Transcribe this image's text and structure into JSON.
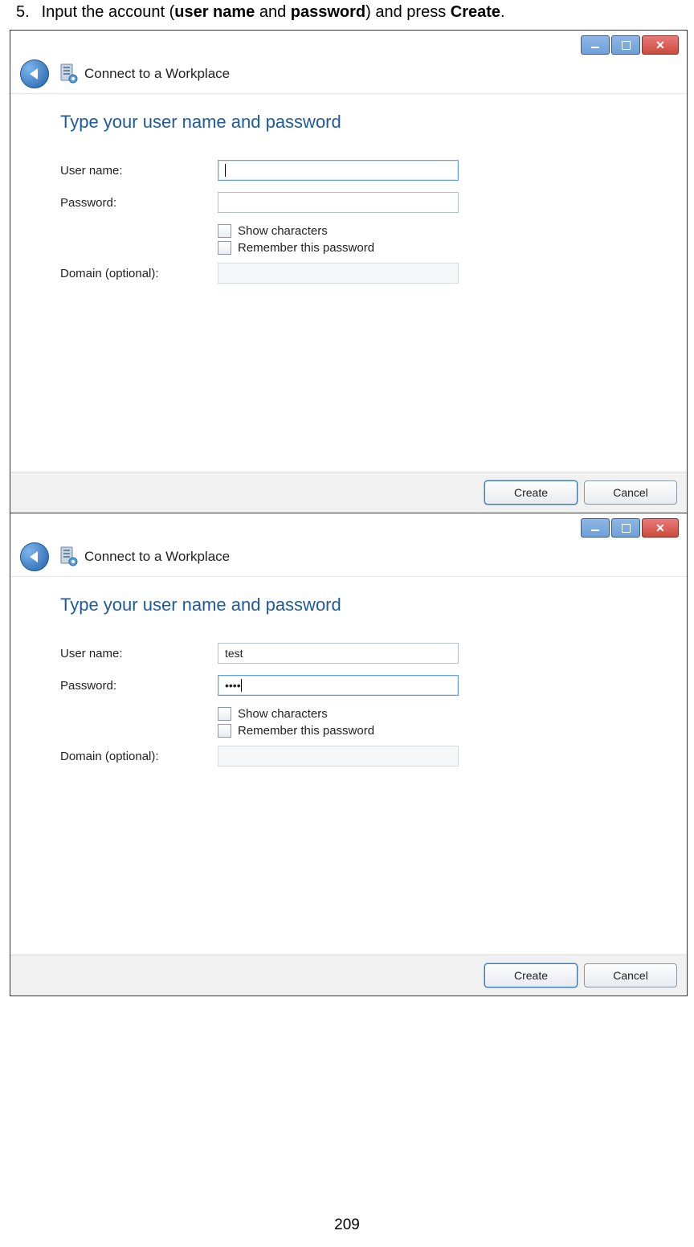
{
  "instruction": {
    "number": "5.",
    "prefix": "Input the account (",
    "bold1": "user name",
    "mid": " and ",
    "bold2": "password",
    "mid2": ") and press ",
    "bold3": "Create",
    "suffix": "."
  },
  "wizard": {
    "title": "Connect to a Workplace",
    "heading": "Type your user name and password",
    "labels": {
      "username": "User name:",
      "password": "Password:",
      "domain": "Domain (optional):"
    },
    "checks": {
      "show": "Show characters",
      "remember": "Remember this password"
    },
    "buttons": {
      "create": "Create",
      "cancel": "Cancel"
    }
  },
  "screens": [
    {
      "username_value": "",
      "password_value": "",
      "username_focused": true,
      "password_focused": false
    },
    {
      "username_value": "test",
      "password_value": "••••",
      "username_focused": false,
      "password_focused": true
    }
  ],
  "page_number": "209"
}
